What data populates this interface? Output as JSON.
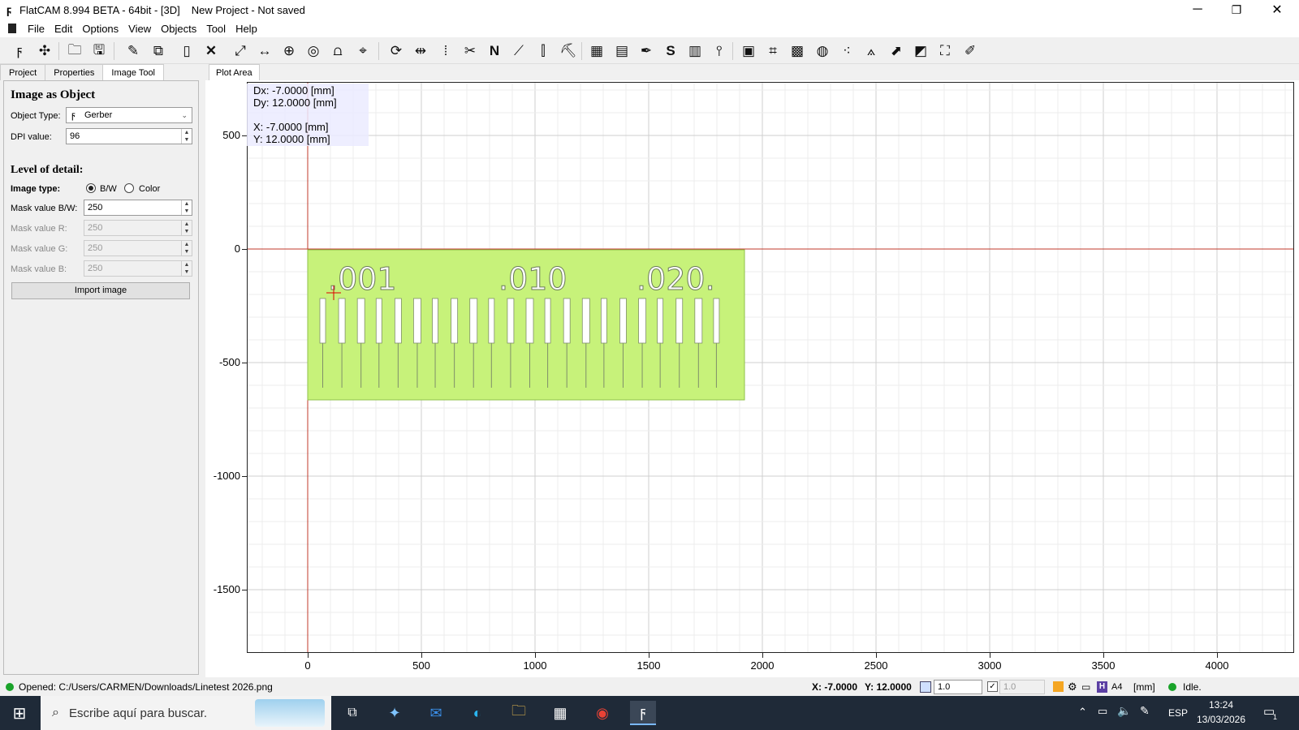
{
  "window": {
    "title": "FlatCAM 8.994 BETA - 64bit - [3D]",
    "project": "New Project - Not saved",
    "minimize": "─",
    "maximize": "❐",
    "close": "✕"
  },
  "menu": [
    "File",
    "Edit",
    "Options",
    "View",
    "Objects",
    "Tool",
    "Help"
  ],
  "left_tabs": [
    "Project",
    "Properties",
    "Image Tool"
  ],
  "image_tool": {
    "heading": "Image as Object",
    "object_type_label": "Object Type:",
    "object_type_value": "Gerber",
    "dpi_label": "DPI value:",
    "dpi_value": "96",
    "detail_heading": "Level of detail:",
    "image_type_label": "Image type:",
    "bw_label": "B/W",
    "color_label": "Color",
    "mask_bw_label": "Mask value B/W:",
    "mask_bw_value": "250",
    "mask_r_label": "Mask value R:",
    "mask_r_value": "250",
    "mask_g_label": "Mask value G:",
    "mask_g_value": "250",
    "mask_b_label": "Mask value B:",
    "mask_b_value": "250",
    "import_button": "Import image"
  },
  "plot": {
    "tab": "Plot Area",
    "x_ticks": [
      "0",
      "500",
      "1000",
      "1500",
      "2000",
      "2500",
      "3000",
      "3500",
      "4000"
    ],
    "y_ticks": [
      "500",
      "0",
      "-500",
      "-1000",
      "-1500"
    ],
    "coords": {
      "dx": "Dx:    -7.0000 [mm]",
      "dy": "Dy:    12.0000 [mm]",
      "x": "X:      -7.0000 [mm]",
      "y": "Y:      12.0000 [mm]"
    },
    "image_labels": [
      ".001",
      ".010",
      ".020."
    ],
    "image_fill": "#c7f27a"
  },
  "status": {
    "message": "Opened: C:/Users/CARMEN/Downloads/Linetest 2026.png",
    "x": "X: -7.0000",
    "y": "Y: 12.0000",
    "grid1": "1.0",
    "grid2": "1.0",
    "page": "A4",
    "units": "[mm]",
    "state": "Idle."
  },
  "taskbar": {
    "search_placeholder": "Escribe aquí para buscar.",
    "lang": "ESP",
    "time": "13:24",
    "date": "13/03/2026",
    "notif": "1"
  }
}
